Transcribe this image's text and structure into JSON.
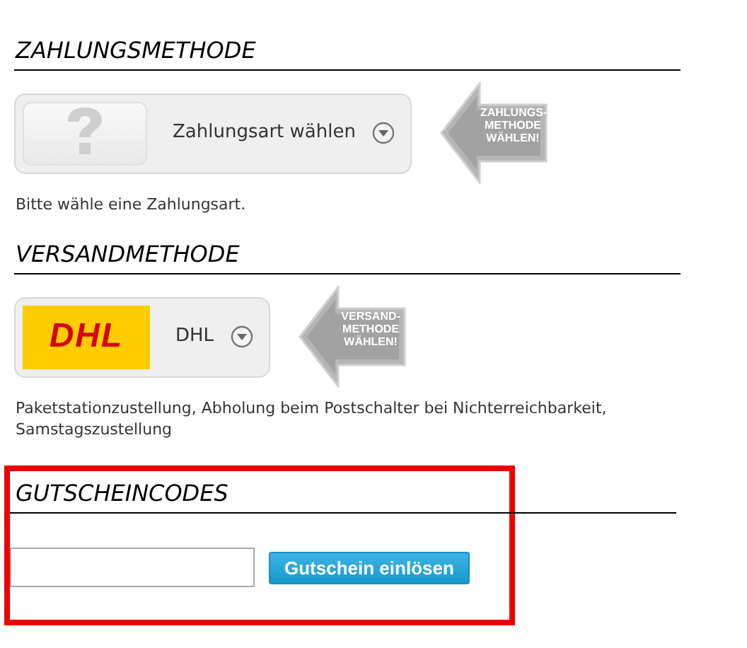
{
  "sections": [
    {
      "kind": "method",
      "heading": "ZAHLUNGSMETHODE",
      "select": {
        "kind": "question",
        "label": "Zahlungsart wählen"
      },
      "arrow_lines": [
        "ZAHLUNGS-",
        "METHODE",
        "WÄHLEN!"
      ],
      "note": "Bitte wähle eine Zahlungsart."
    },
    {
      "kind": "method",
      "heading": "VERSANDMETHODE",
      "select": {
        "kind": "dhl",
        "logo_text": "DHL",
        "label": "DHL"
      },
      "arrow_lines": [
        "VERSAND-",
        "METHODE",
        "WÄHLEN!"
      ],
      "note": "Paketstationzustellung, Abholung beim Postschalter bei Nichterreichbarkeit, Samstagszustellung"
    },
    {
      "kind": "voucher",
      "heading": "GUTSCHEINCODES",
      "highlighted": true,
      "button": "Gutschein einlösen"
    }
  ]
}
